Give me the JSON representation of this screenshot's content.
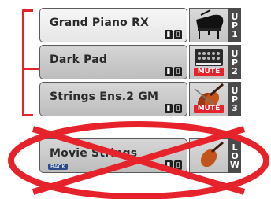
{
  "tracks": [
    {
      "name": "Grand Piano RX",
      "label_chars": [
        "U",
        "P",
        "1"
      ],
      "mute": "",
      "selected": true,
      "icon": "grand-piano-icon"
    },
    {
      "name": "Dark Pad",
      "label_chars": [
        "U",
        "P",
        "2"
      ],
      "mute": "MUTE",
      "selected": false,
      "icon": "synth-pad-icon"
    },
    {
      "name": "Strings Ens.2 GM",
      "label_chars": [
        "U",
        "P",
        "3"
      ],
      "mute": "MUTE",
      "selected": false,
      "icon": "violin-icon"
    }
  ],
  "crossed_track": {
    "name": "Movie Strings",
    "sub": "BACK",
    "label_chars": [
      "L",
      "O",
      "W"
    ],
    "icon": "violin-icon"
  },
  "status_glyphs": [
    "◼",
    "▢"
  ],
  "colors": {
    "accent": "#e6232a",
    "selected_bg": "#f0f0f0",
    "normal_bg": "#c8c8c8",
    "label_bg": "#4a4a4a"
  }
}
